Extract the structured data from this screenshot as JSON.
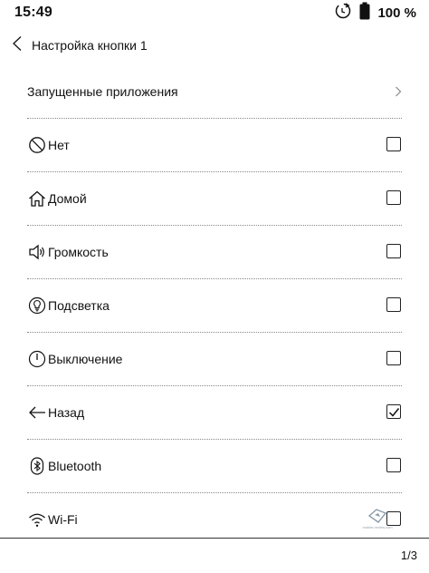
{
  "status": {
    "time": "15:49",
    "battery_percent": "100 %",
    "icons": [
      "sync-icon",
      "battery-icon"
    ]
  },
  "header": {
    "title": "Настройка кнопки 1",
    "back_icon": "chevron-left-icon"
  },
  "menu": {
    "running_apps_label": "Запущенные приложения",
    "items": [
      {
        "label": "Нет",
        "icon": "no-icon",
        "checked": false
      },
      {
        "label": "Домой",
        "icon": "home-icon",
        "checked": false
      },
      {
        "label": "Громкость",
        "icon": "volume-icon",
        "checked": false
      },
      {
        "label": "Подсветка",
        "icon": "lightbulb-icon",
        "checked": false
      },
      {
        "label": "Выключение",
        "icon": "power-icon",
        "checked": false
      },
      {
        "label": "Назад",
        "icon": "arrow-left-icon",
        "checked": true
      },
      {
        "label": "Bluetooth",
        "icon": "bluetooth-icon",
        "checked": false
      },
      {
        "label": "Wi-Fi",
        "icon": "wifi-icon",
        "checked": false
      }
    ]
  },
  "pager": {
    "text": "1/3"
  },
  "watermark": {
    "text": "mobile-review.com"
  },
  "colors": {
    "text": "#111111",
    "divider": "#888888",
    "background": "#ffffff"
  }
}
